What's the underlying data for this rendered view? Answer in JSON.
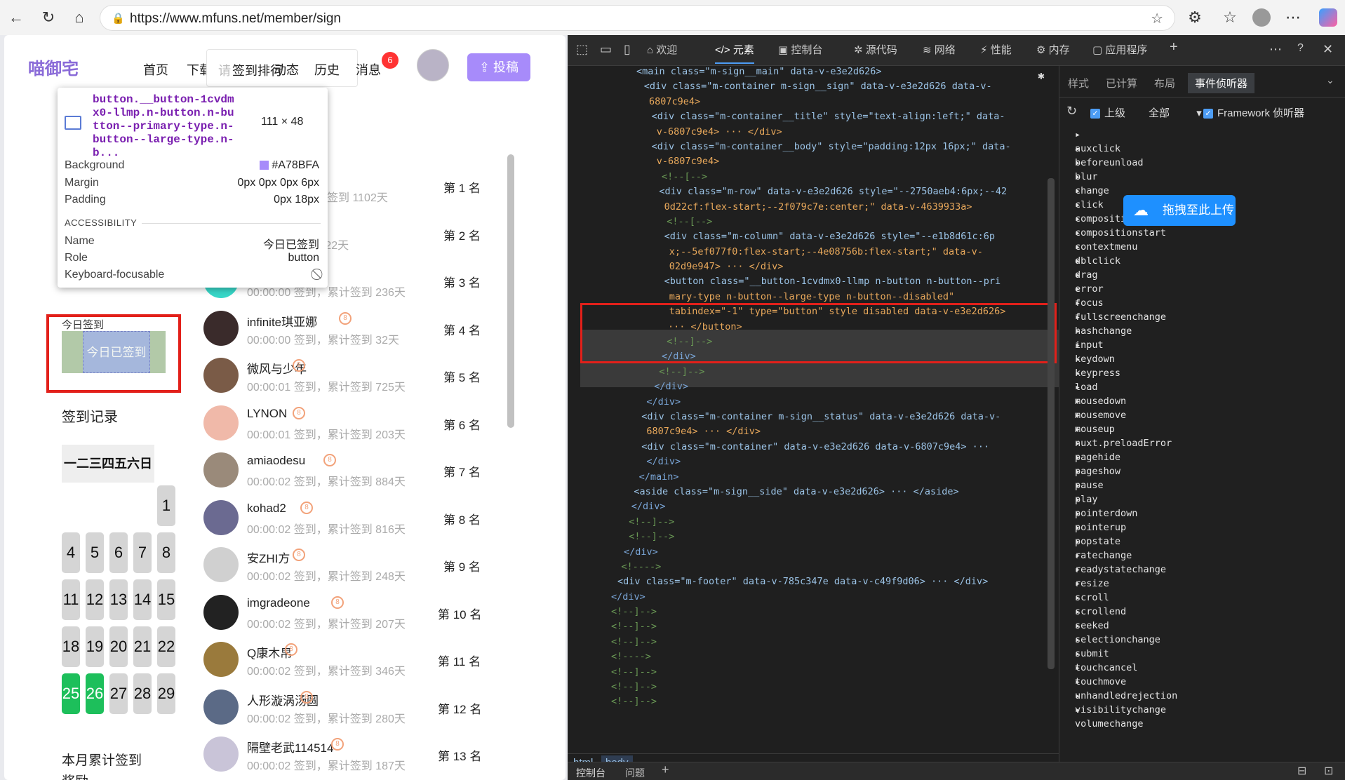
{
  "browser": {
    "url": "https://www.mfuns.net/member/sign"
  },
  "site": {
    "logo": "喵御宅",
    "nav": [
      "首页",
      "下载",
      "动态",
      "历史",
      "消息"
    ],
    "search_placeholder": "请",
    "search_overlay": "签到排行",
    "messages_badge": "6",
    "post_button": "投稿"
  },
  "inspect_tooltip": {
    "selector": "button.__button-1cvdmx0-llmp.n-button.n-button--primary-type.n-button--large-type.n-b...",
    "size": "111 × 48",
    "rows": [
      {
        "label": "Background",
        "value": "#A78BFA"
      },
      {
        "label": "Margin",
        "value": "0px 0px 0px 6px"
      },
      {
        "label": "Padding",
        "value": "0px 18px"
      }
    ],
    "accessibility_heading": "ACCESSIBILITY",
    "acc_rows": [
      {
        "label": "Name",
        "value": "今日已签到"
      },
      {
        "label": "Role",
        "value": "button"
      },
      {
        "label": "Keyboard-focusable",
        "value": ""
      }
    ],
    "swatch_color": "#A78BFA"
  },
  "sign": {
    "label": "今日签到",
    "button": "今日已签到",
    "record_title": "签到记录",
    "weekdays": "一二三四五六日",
    "days": [
      "1",
      "4",
      "5",
      "6",
      "7",
      "8",
      "11",
      "12",
      "13",
      "14",
      "15",
      "18",
      "19",
      "20",
      "21",
      "22",
      "25",
      "26",
      "27",
      "28",
      "29"
    ],
    "signed_days": [
      "25",
      "26"
    ],
    "monthly": "本月累计签到",
    "reward": "奖励"
  },
  "rank": [
    {
      "name": "",
      "time": "签到，累计签到 1102天",
      "rank": "第 1 名",
      "color": "#cfc6e4"
    },
    {
      "name": "",
      "time": "累计签到 422天",
      "rank": "第 2 名",
      "color": "#d6e6f2"
    },
    {
      "name": "",
      "time": "00:00:00 签到，累计签到 236天",
      "rank": "第 3 名",
      "color": "#37d7c8"
    },
    {
      "name": "infinite琪亚娜",
      "time": "00:00:00 签到，累计签到 32天",
      "rank": "第 4 名",
      "color": "#3a2b2b"
    },
    {
      "name": "微风与少年",
      "time": "00:00:01 签到，累计签到 725天",
      "rank": "第 5 名",
      "color": "#7a5b47"
    },
    {
      "name": "LYNON",
      "time": "00:00:01 签到，累计签到 203天",
      "rank": "第 6 名",
      "color": "#f0b9a9"
    },
    {
      "name": "amiaodesu",
      "time": "00:00:02 签到，累计签到 884天",
      "rank": "第 7 名",
      "color": "#9a8a7a"
    },
    {
      "name": "kohad2",
      "time": "00:00:02 签到，累计签到 816天",
      "rank": "第 8 名",
      "color": "#6b6a91"
    },
    {
      "name": "安ZHI方",
      "time": "00:00:02 签到，累计签到 248天",
      "rank": "第 9 名",
      "color": "#d0d0d0"
    },
    {
      "name": "imgradeone",
      "time": "00:00:02 签到，累计签到 207天",
      "rank": "第 10 名",
      "color": "#222222"
    },
    {
      "name": "Q康木帛",
      "time": "00:00:02 签到，累计签到 346天",
      "rank": "第 11 名",
      "color": "#9a7a3c"
    },
    {
      "name": "人形漩涡汤圆",
      "time": "00:00:02 签到，累计签到 280天",
      "rank": "第 12 名",
      "color": "#5b6a86"
    },
    {
      "name": "隔壁老武114514",
      "time": "00:00:02 签到，累计签到 187天",
      "rank": "第 13 名",
      "color": "#c9c4d8"
    }
  ],
  "devtools": {
    "tabs": [
      "欢迎",
      "元素",
      "控制台",
      "源代码",
      "网络",
      "性能",
      "内存",
      "应用程序"
    ],
    "side_tabs": [
      "样式",
      "已计算",
      "布局",
      "事件侦听器"
    ],
    "filter_ancestors": "上级",
    "filter_all": "全部",
    "framework": "Framework 侦听器",
    "events": [
      "auxclick",
      "beforeunload",
      "blur",
      "change",
      "click",
      "compositionend",
      "compositionstart",
      "contextmenu",
      "dblclick",
      "drag",
      "error",
      "focus",
      "fullscreenchange",
      "hashchange",
      "input",
      "keydown",
      "keypress",
      "load",
      "mousedown",
      "mousemove",
      "mouseup",
      "nuxt.preloadError",
      "pagehide",
      "pageshow",
      "pause",
      "play",
      "pointerdown",
      "pointerup",
      "popstate",
      "ratechange",
      "readystatechange",
      "resize",
      "scroll",
      "scrollend",
      "seeked",
      "selectionchange",
      "submit",
      "touchcancel",
      "touchmove",
      "unhandledrejection",
      "visibilitychange",
      "volumechange"
    ],
    "upload_overlay": "拖拽至此上传",
    "crumbs": [
      "html",
      "body"
    ],
    "drawer_tabs": [
      "控制台",
      "问题"
    ],
    "tree": [
      "<main class=\"m-sign__main\" data-v-e3e2d626>",
      "<div class=\"m-container m-sign__sign\" data-v-e3e2d626 data-v-",
      "6807c9e4>",
      "<div class=\"m-container__title\" style=\"text-align:left;\" data-",
      "v-6807c9e4> ··· </div>",
      "<div class=\"m-container__body\" style=\"padding:12px 16px;\" data-",
      "v-6807c9e4>",
      "<!--[-->",
      "<div class=\"m-row\" data-v-e3e2d626 style=\"--2750aeb4:6px;--42",
      "0d22cf:flex-start;--2f079c7e:center;\" data-v-4639933a>",
      "<!--[-->",
      "<div class=\"m-column\" data-v-e3e2d626 style=\"--e1b8d61c:6p",
      "x;--5ef077f0:flex-start;--4e08756b:flex-start;\" data-v-",
      "02d9e947> ··· </div>",
      "<button class=\"__button-1cvdmx0-llmp n-button n-button--pri",
      "mary-type n-button--large-type n-button--disabled\"",
      "tabindex=\"-1\" type=\"button\" style disabled data-v-e3e2d626>",
      "··· </button>",
      "<!--]-->",
      "</div>",
      "<!--]-->",
      "</div>",
      "</div>",
      "<div class=\"m-container m-sign__status\" data-v-e3e2d626 data-v-",
      "6807c9e4> ··· </div>",
      "<div class=\"m-container\" data-v-e3e2d626 data-v-6807c9e4> ···",
      "</div>",
      "</main>",
      "<aside class=\"m-sign__side\" data-v-e3e2d626> ··· </aside>",
      "</div>",
      "<!--]-->",
      "<!--]-->",
      "</div>",
      "<!---->",
      "<div class=\"m-footer\" data-v-785c347e data-v-c49f9d06> ··· </div>",
      "</div>",
      "<!--]-->",
      "<!--]-->",
      "<!--]-->",
      "<!---->",
      "<!--]-->",
      "<!--]-->",
      "<!--]-->"
    ]
  }
}
